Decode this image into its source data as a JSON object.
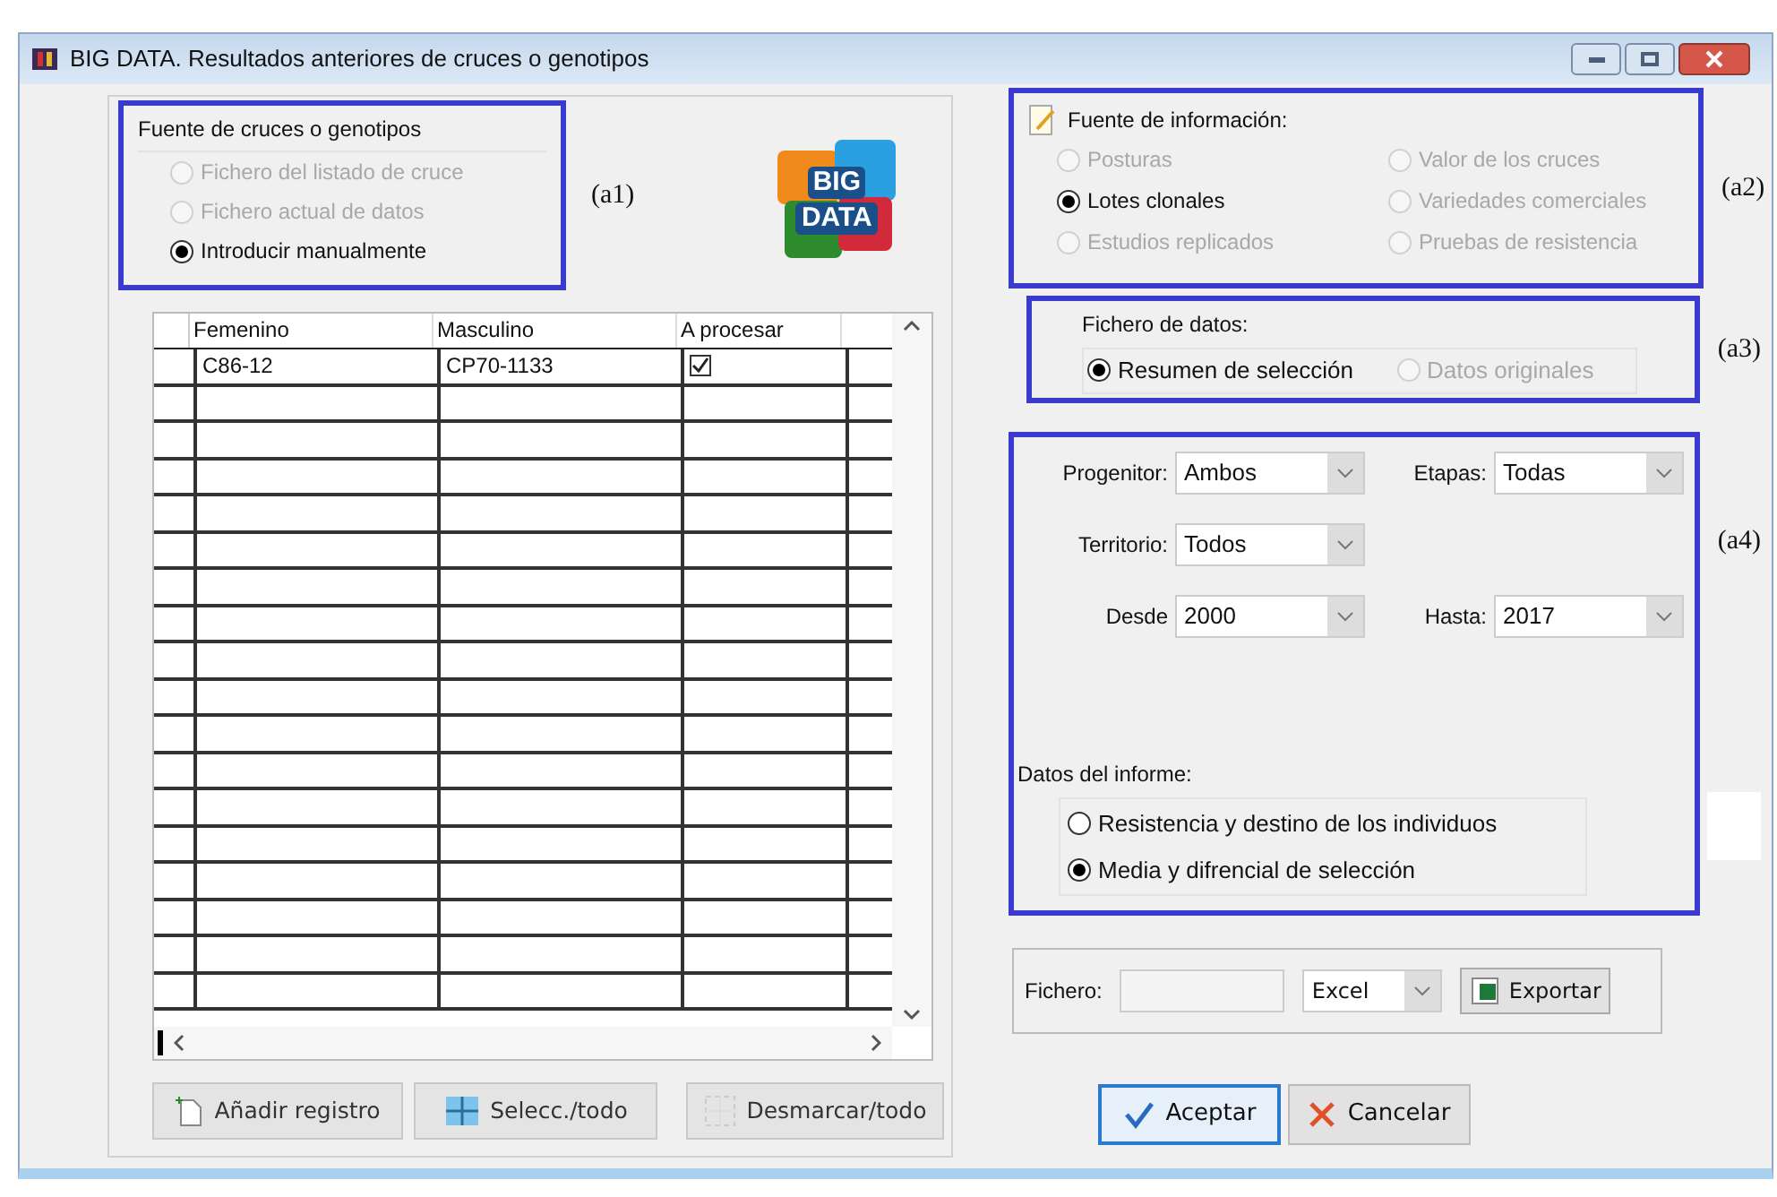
{
  "window": {
    "title": "BIG DATA. Resultados anteriores de cruces o genotipos"
  },
  "source_group": {
    "title": "Fuente de cruces o genotipos",
    "annotation": "(a1)",
    "options": [
      {
        "label": "Fichero del listado de cruce",
        "selected": false,
        "disabled": true
      },
      {
        "label": "Fichero actual de datos",
        "selected": false,
        "disabled": true
      },
      {
        "label": "Introducir manualmente",
        "selected": true,
        "disabled": false
      }
    ]
  },
  "logo": {
    "line1": "BIG",
    "line2": "DATA"
  },
  "grid": {
    "columns": [
      "Femenino",
      "Masculino",
      "A procesar"
    ],
    "rows": [
      {
        "femenino": "C86-12",
        "masculino": "CP70-1133",
        "a_procesar": true
      }
    ]
  },
  "grid_buttons": [
    {
      "label": "Añadir registro",
      "kind": "add"
    },
    {
      "label": "Selecc./todo",
      "kind": "select"
    },
    {
      "label": "Desmarcar/todo",
      "kind": "unselect"
    }
  ],
  "info_group": {
    "title": "Fuente de información:",
    "annotation": "(a2)",
    "options": [
      {
        "label": "Posturas",
        "selected": false,
        "disabled": true
      },
      {
        "label": "Valor de los cruces",
        "selected": false,
        "disabled": true
      },
      {
        "label": "Lotes clonales",
        "selected": true,
        "disabled": false
      },
      {
        "label": "Variedades comerciales",
        "selected": false,
        "disabled": true
      },
      {
        "label": "Estudios replicados",
        "selected": false,
        "disabled": true
      },
      {
        "label": "Pruebas de resistencia",
        "selected": false,
        "disabled": true
      }
    ]
  },
  "data_file": {
    "title": "Fichero de datos:",
    "annotation": "(a3)",
    "options": [
      {
        "label": "Resumen de selección",
        "selected": true,
        "disabled": false
      },
      {
        "label": "Datos originales",
        "selected": false,
        "disabled": true
      }
    ]
  },
  "filters": {
    "annotation": "(a4)",
    "fields": [
      {
        "label": "Progenitor:",
        "value": "Ambos"
      },
      {
        "label": "Etapas:",
        "value": "Todas"
      },
      {
        "label": "Territorio:",
        "value": "Todos"
      },
      {
        "label": "Desde",
        "value": "2000"
      },
      {
        "label": "Hasta:",
        "value": "2017"
      }
    ],
    "report": {
      "title": "Datos del informe:",
      "options": [
        {
          "label": "Resistencia y destino de los individuos",
          "selected": false
        },
        {
          "label": "Media y difrencial de selección",
          "selected": true
        }
      ]
    }
  },
  "export": {
    "label": "Fichero:",
    "format": "Excel",
    "button": "Exportar"
  },
  "actions": [
    {
      "label": "Aceptar",
      "kind": "ok",
      "default": true
    },
    {
      "label": "Cancelar",
      "kind": "cancel",
      "default": false
    }
  ]
}
